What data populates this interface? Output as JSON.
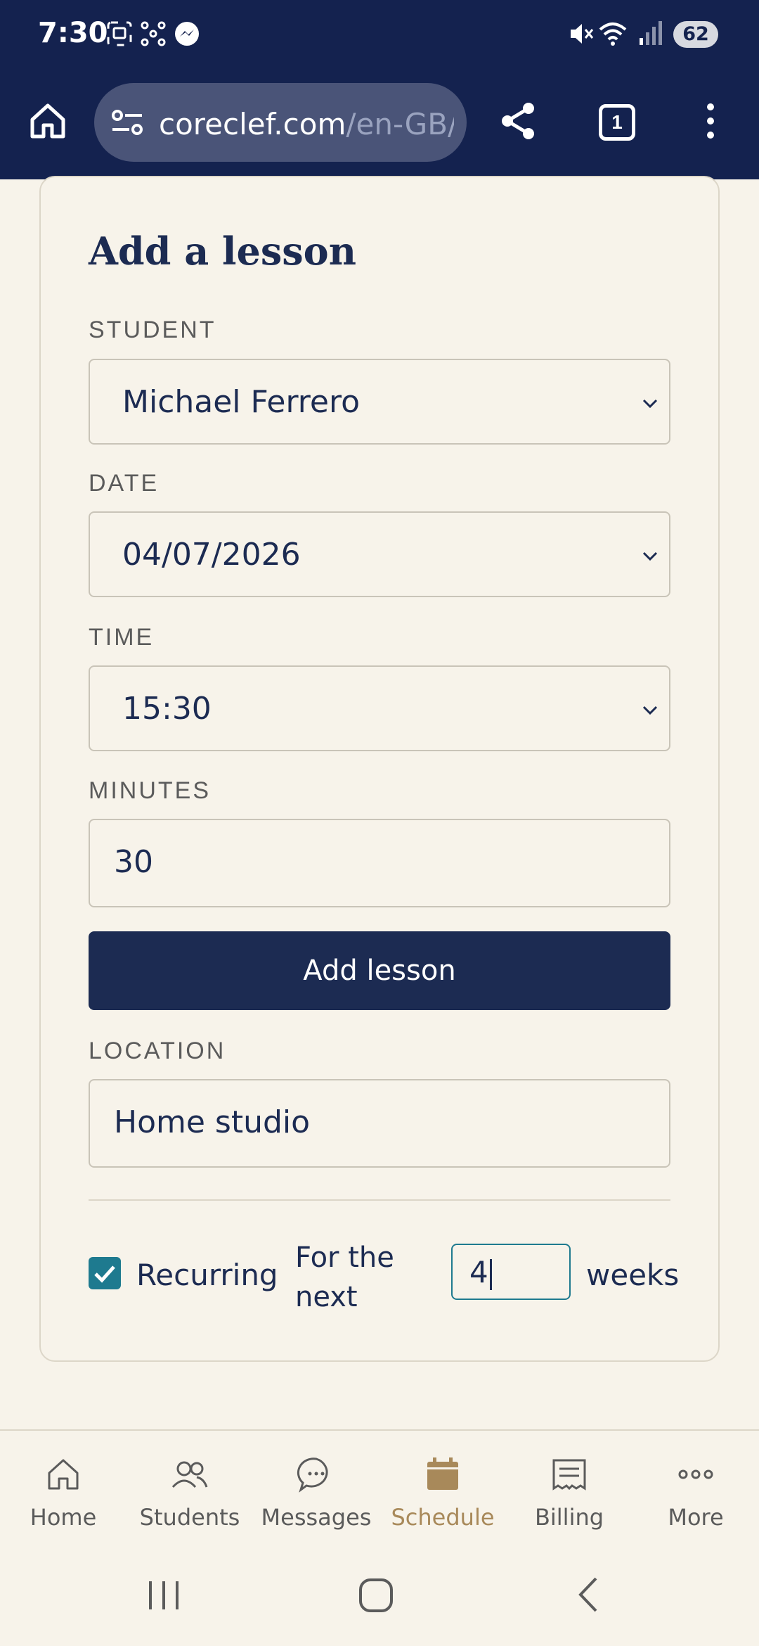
{
  "status_bar": {
    "time": "7:30",
    "battery": "62",
    "icons": [
      "screenshot-icon",
      "network-icon",
      "messenger-icon",
      "mute-icon",
      "wifi-icon",
      "signal-icon"
    ]
  },
  "browser": {
    "url_host": "coreclef.com",
    "url_path": "/en-GB/",
    "tab_count": "1"
  },
  "form": {
    "title": "Add a lesson",
    "student_label": "STUDENT",
    "student_value": "Michael Ferrero",
    "date_label": "DATE",
    "date_value": "04/07/2026",
    "time_label": "TIME",
    "time_value": "15:30",
    "minutes_label": "MINUTES",
    "minutes_value": "30",
    "submit_label": "Add lesson",
    "location_label": "LOCATION",
    "location_value": "Home studio",
    "recurring_label": "Recurring",
    "recurring_checked": true,
    "for_the_next": "For the next",
    "weeks_value": "4",
    "weeks_label": "weeks"
  },
  "bottom_nav": {
    "items": [
      {
        "label": "Home",
        "icon": "home-icon"
      },
      {
        "label": "Students",
        "icon": "students-icon"
      },
      {
        "label": "Messages",
        "icon": "messages-icon"
      },
      {
        "label": "Schedule",
        "icon": "calendar-icon",
        "active": true
      },
      {
        "label": "Billing",
        "icon": "receipt-icon"
      },
      {
        "label": "More",
        "icon": "more-icon"
      }
    ]
  },
  "colors": {
    "navy": "#14224f",
    "button": "#1c2b52",
    "background": "#f7f3ea",
    "accent_teal": "#1e7a8f",
    "active_gold": "#a8895a"
  }
}
